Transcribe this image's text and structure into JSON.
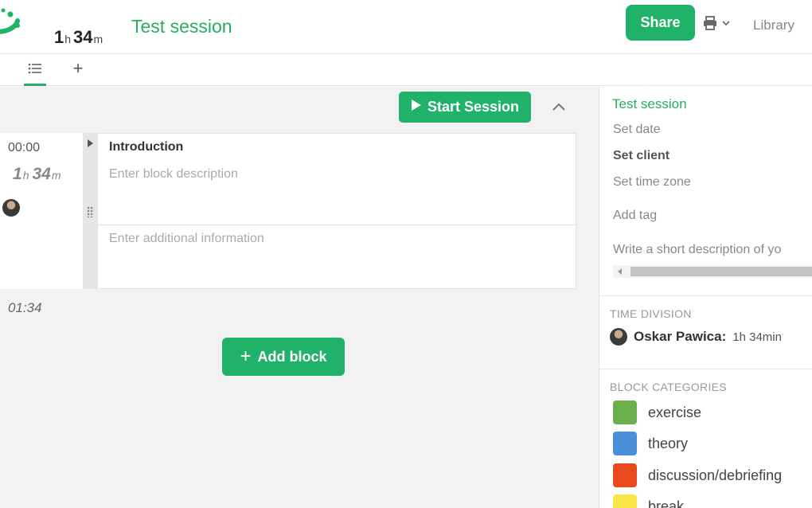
{
  "header": {
    "duration": {
      "hours": "1",
      "hours_unit": "h",
      "minutes": "34",
      "minutes_unit": "m"
    },
    "session_title": "Test session",
    "share_label": "Share",
    "library_label": "Library"
  },
  "tabs": {
    "add_label": "+"
  },
  "toolbar": {
    "start_session_label": "Start Session"
  },
  "blocks": [
    {
      "start_time": "00:00",
      "duration": {
        "hours": "1",
        "hours_unit": "h",
        "minutes": "34",
        "minutes_unit": "m"
      },
      "title": "Introduction",
      "description_placeholder": "Enter block description",
      "info_placeholder": "Enter additional information"
    }
  ],
  "end_time": "01:34",
  "add_block_label": "Add block",
  "panel": {
    "title": "Test session",
    "set_date": "Set date",
    "set_client": "Set client",
    "set_time_zone": "Set time zone",
    "add_tag": "Add tag",
    "description_placeholder": "Write a short description of yo",
    "time_division_heading": "TIME DIVISION",
    "time_division": [
      {
        "name": "Oskar Pawica:",
        "time": "1h 34min"
      }
    ],
    "block_categories_heading": "BLOCK CATEGORIES",
    "categories": [
      {
        "label": "exercise",
        "color": "#6ab04c"
      },
      {
        "label": "theory",
        "color": "#4a90d9"
      },
      {
        "label": "discussion/debriefing",
        "color": "#e8491d"
      },
      {
        "label": "break",
        "color": "#f9e547"
      }
    ]
  },
  "colors": {
    "accent": "#21b26a",
    "accent_text": "#27ae60"
  }
}
